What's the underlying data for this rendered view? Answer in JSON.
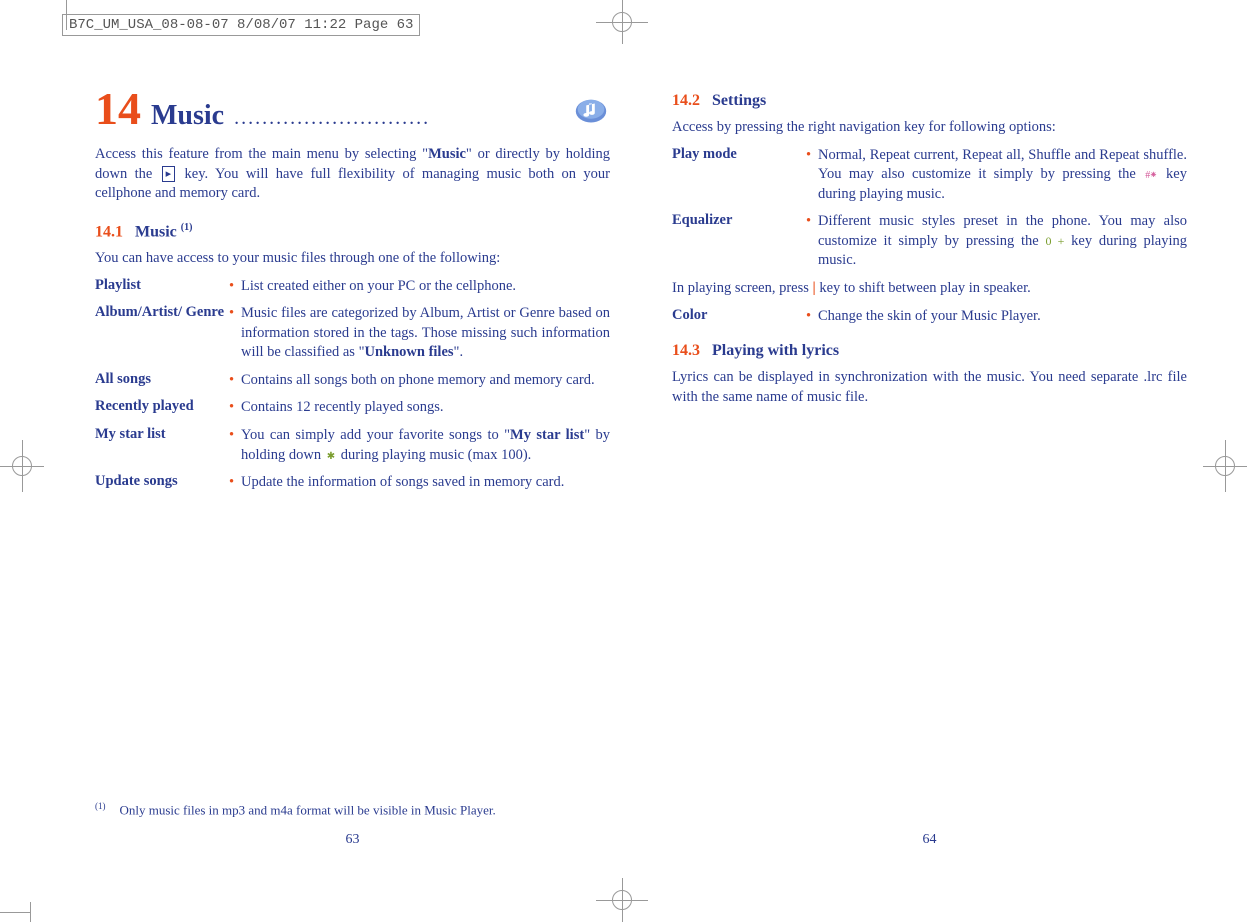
{
  "header": {
    "filename_line": "B7C_UM_USA_08-08-07  8/08/07  11:22  Page 63"
  },
  "left_page": {
    "chapter_number": "14",
    "chapter_title": "Music",
    "dots": "............................",
    "intro_pre": "Access this feature from the main menu by selecting \"",
    "intro_bold1": "Music",
    "intro_mid": "\" or directly by holding down the ",
    "intro_key": "▸",
    "intro_post": " key. You will have full flexibility of managing music both on your cellphone and memory card.",
    "section1_num": "14.1",
    "section1_title": "Music ",
    "section1_sup": "(1)",
    "section1_lead": "You can have access to your music files through one of the following:",
    "items": [
      {
        "term": "Playlist",
        "desc": "List created either on your PC or the cellphone."
      },
      {
        "term": "Album/Artist/ Genre",
        "desc_pre": "Music files are categorized by Album, Artist or Genre based on information stored in the tags. Those missing such information will be classified as \"",
        "desc_bold": "Unknown files",
        "desc_post": "\"."
      },
      {
        "term": "All songs",
        "desc": "Contains all songs both on phone memory and memory card."
      },
      {
        "term": "Recently played",
        "desc": "Contains 12 recently played songs."
      },
      {
        "term": "My star list",
        "desc_pre": "You can simply add your favorite songs to \"",
        "desc_bold": "My star list",
        "desc_mid": "\" by holding down ",
        "desc_post": " during playing music (max 100)."
      },
      {
        "term": "Update songs",
        "desc": "Update the information of songs saved in memory card."
      }
    ],
    "footnote_sup": "(1)",
    "footnote": "Only music files in mp3 and m4a format will be visible in Music Player.",
    "page_number": "63"
  },
  "right_page": {
    "section2_num": "14.2",
    "section2_title": "Settings",
    "section2_lead": "Access by pressing the right navigation key for following options:",
    "items2": [
      {
        "term": "Play mode",
        "desc_pre": "Normal, Repeat current, Repeat all, Shuffle and Repeat shuffle. You may also customize it simply by pressing the ",
        "desc_post": " key during playing music."
      },
      {
        "term": "Equalizer",
        "desc_pre": "Different music styles preset in the phone. You may also customize it simply by pressing the ",
        "desc_key": "0 +",
        "desc_post": " key during playing music."
      }
    ],
    "speaker_pre": "In playing screen, press ",
    "speaker_bar": "|",
    "speaker_post": " key to shift between play in speaker.",
    "items3": [
      {
        "term": "Color",
        "desc": "Change the skin of your Music Player."
      }
    ],
    "section3_num": "14.3",
    "section3_title": "Playing with lyrics",
    "section3_body": "Lyrics can be displayed in synchronization with the music. You need separate .lrc file with the same name of music file.",
    "page_number": "64"
  }
}
